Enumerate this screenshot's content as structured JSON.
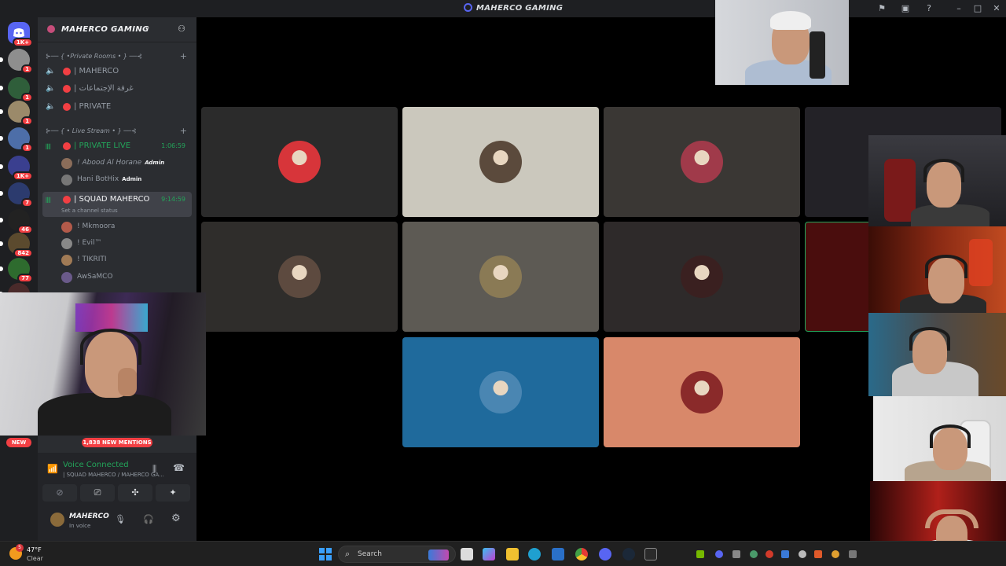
{
  "window": {
    "title": "MAHERCO GAMING"
  },
  "rail": {
    "home_badge": "1K+",
    "servers": [
      {
        "color": "#8e8e8e",
        "badge": "1"
      },
      {
        "color": "#2f5e3a",
        "badge": "1"
      },
      {
        "color": "#9b8a6a",
        "badge": "1"
      },
      {
        "color": "#4d6ea8",
        "badge": "1"
      },
      {
        "color": "#3a3f8f",
        "badge": "1K+"
      },
      {
        "color": "#2c3b6e",
        "badge": "7"
      },
      {
        "color": "#222222",
        "badge": "46"
      },
      {
        "color": "#5b4a2e",
        "badge": "842"
      },
      {
        "color": "#2e6b2e",
        "badge": "77"
      },
      {
        "color": "#4a2a2a",
        "badge": ""
      }
    ]
  },
  "sidebar": {
    "server_name": "MAHERCO GAMING",
    "categories": [
      {
        "label": "⊱── { •Private Rooms • } ──⊰"
      },
      {
        "label": "⊱── { • Live Stream • } ──⊰"
      }
    ],
    "channels": [
      {
        "name": "| MAHERCO",
        "timer": ""
      },
      {
        "name": "| غرفة الإجتماعات",
        "timer": ""
      },
      {
        "name": "| PRIVATE",
        "timer": ""
      },
      {
        "name": "| PRIVATE LIVE",
        "timer": "1:06:59"
      },
      {
        "name": "| SQUAD MAHERCO",
        "timer": "9:14:59"
      }
    ],
    "live_users": [
      {
        "name": "! Abood Al Horane",
        "role": "Admin",
        "color": "#8b6d5a"
      },
      {
        "name": "Hani BotHix",
        "role": "Admin",
        "color": "#777777"
      }
    ],
    "channel_status_placeholder": "Set a channel status",
    "squad_users": [
      {
        "name": "! Mkmoora",
        "color": "#b35a4a"
      },
      {
        "name": "! Evil™",
        "color": "#888888"
      },
      {
        "name": "! TIKRITI",
        "color": "#a07a55"
      },
      {
        "name": "AwSaMCO",
        "color": "#6a5a8a"
      }
    ],
    "new_pill": "NEW",
    "mentions_pill": "1,838 NEW MENTIONS",
    "voice": {
      "status": "Voice Connected",
      "channel": "| SQUAD MAHERCO / MAHERCO GA..."
    },
    "self": {
      "name": "MAHERCO",
      "status": "In voice"
    }
  },
  "stage": {
    "tiles": [
      {
        "bg": "#2b2b2b",
        "avatar": "#d7353a"
      },
      {
        "bg": "#cbc8bd",
        "avatar": "#5b4a3c"
      },
      {
        "bg": "#3a3734",
        "avatar": "#a03a4a"
      },
      {
        "bg": "#232227",
        "avatar": ""
      },
      {
        "bg": "#2f2d2b",
        "avatar": "#5d4a3f"
      },
      {
        "bg": "#5d5a54",
        "avatar": "#8a7a55"
      },
      {
        "bg": "#2e2a2a",
        "avatar": "#3a2020"
      },
      {
        "bg": "#4a0d0d",
        "avatar": ""
      },
      {
        "bg": "#1f6a9c",
        "avatar": "#4a86b2"
      },
      {
        "bg": "#d8886a",
        "avatar": "#8a2a2a"
      }
    ]
  },
  "taskbar": {
    "weather_temp": "47°F",
    "weather_cond": "Clear",
    "weather_badge": "5",
    "search_placeholder": "Search"
  },
  "colors": {
    "accent": "#5865f2",
    "online": "#23a55a",
    "danger": "#f23f43"
  }
}
